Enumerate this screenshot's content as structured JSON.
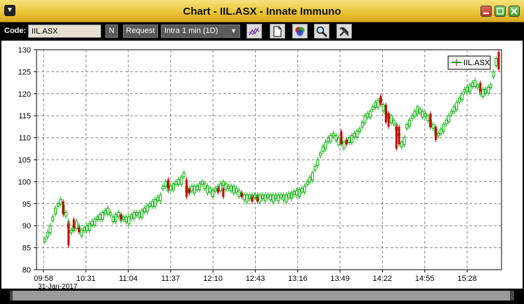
{
  "window": {
    "title": "Chart - IIL.ASX - Innate Immuno",
    "menu_glyph": "▼"
  },
  "toolbar": {
    "code_label": "Code:",
    "code_value": "IIL.ASX",
    "n_label": "N",
    "request_label": "Request",
    "interval_value": "Intra 1 min (1D)",
    "icons": [
      "indicator-chart-icon",
      "document-icon",
      "color-palette-icon",
      "zoom-icon",
      "tools-icon"
    ]
  },
  "chart_data": {
    "type": "candlestick",
    "legend": "IIL.ASX",
    "legend_placement": "top-right",
    "grid": true,
    "ylim": [
      80,
      130
    ],
    "yticks": [
      80,
      85,
      90,
      95,
      100,
      105,
      110,
      115,
      120,
      125,
      130
    ],
    "xticks": [
      "09:58",
      "10:31",
      "11:04",
      "11:37",
      "12:10",
      "12:43",
      "13:16",
      "13:49",
      "14:22",
      "14:55",
      "15:28"
    ],
    "xdate": "31-Jan-2017",
    "colors": {
      "up": "#00b000",
      "down": "#cc0000",
      "grid": "#888888"
    },
    "close_path": [
      [
        0,
        87
      ],
      [
        2,
        90
      ],
      [
        4,
        94
      ],
      [
        6,
        96
      ],
      [
        8,
        93
      ],
      [
        10,
        89
      ],
      [
        12,
        91
      ],
      [
        14,
        89
      ],
      [
        16,
        90
      ],
      [
        18,
        91
      ],
      [
        20,
        92
      ],
      [
        22,
        93
      ],
      [
        24,
        94
      ],
      [
        26,
        92
      ],
      [
        28,
        93
      ],
      [
        30,
        92
      ],
      [
        32,
        92
      ],
      [
        34,
        93
      ],
      [
        36,
        93
      ],
      [
        38,
        94
      ],
      [
        40,
        95
      ],
      [
        42,
        96
      ],
      [
        44,
        97
      ],
      [
        45,
        99
      ],
      [
        46,
        100
      ],
      [
        48,
        99
      ],
      [
        50,
        100
      ],
      [
        52,
        101
      ],
      [
        53,
        102
      ],
      [
        54,
        99
      ],
      [
        55,
        98
      ],
      [
        56,
        99
      ],
      [
        58,
        99
      ],
      [
        60,
        100
      ],
      [
        62,
        99
      ],
      [
        64,
        98
      ],
      [
        66,
        99
      ],
      [
        68,
        100
      ],
      [
        70,
        99
      ],
      [
        72,
        99
      ],
      [
        74,
        98
      ],
      [
        76,
        97
      ],
      [
        78,
        97
      ],
      [
        80,
        97
      ],
      [
        82,
        97
      ],
      [
        84,
        97
      ],
      [
        86,
        97
      ],
      [
        88,
        97
      ],
      [
        90,
        97
      ],
      [
        92,
        97
      ],
      [
        94,
        97.5
      ],
      [
        96,
        98
      ],
      [
        98,
        98.5
      ],
      [
        99,
        99
      ],
      [
        100,
        100
      ],
      [
        102,
        102
      ],
      [
        104,
        105
      ],
      [
        106,
        108
      ],
      [
        108,
        110
      ],
      [
        110,
        111
      ],
      [
        112,
        110
      ],
      [
        114,
        109
      ],
      [
        116,
        110
      ],
      [
        118,
        111
      ],
      [
        120,
        112
      ],
      [
        122,
        115
      ],
      [
        124,
        116
      ],
      [
        125,
        117
      ],
      [
        126,
        118
      ],
      [
        128,
        119
      ],
      [
        130,
        116
      ],
      [
        132,
        115
      ],
      [
        134,
        113
      ],
      [
        135,
        111
      ],
      [
        136,
        109
      ],
      [
        137,
        110
      ],
      [
        138,
        113
      ],
      [
        140,
        115
      ],
      [
        142,
        117
      ],
      [
        144,
        116
      ],
      [
        146,
        115
      ],
      [
        148,
        113
      ],
      [
        150,
        111
      ],
      [
        152,
        113
      ],
      [
        154,
        115
      ],
      [
        156,
        117
      ],
      [
        158,
        119
      ],
      [
        160,
        121
      ],
      [
        162,
        122
      ],
      [
        164,
        123
      ],
      [
        166,
        121
      ],
      [
        168,
        121
      ],
      [
        170,
        122
      ],
      [
        171,
        125
      ],
      [
        172,
        128
      ],
      [
        173,
        130
      ]
    ],
    "down_bars": [
      [
        7,
        96,
        92
      ],
      [
        9,
        91,
        85
      ],
      [
        11,
        92,
        89
      ],
      [
        13,
        90,
        88
      ],
      [
        29,
        93,
        91
      ],
      [
        47,
        101,
        98
      ],
      [
        54,
        101,
        96
      ],
      [
        55,
        99,
        97
      ],
      [
        66,
        99,
        97
      ],
      [
        68,
        99,
        96
      ],
      [
        75,
        98,
        96
      ],
      [
        79,
        97,
        95
      ],
      [
        81,
        97,
        95
      ],
      [
        113,
        112,
        108
      ],
      [
        115,
        110,
        108
      ],
      [
        128,
        120,
        117
      ],
      [
        130,
        118,
        113
      ],
      [
        131,
        116,
        112
      ],
      [
        134,
        113,
        107
      ],
      [
        135,
        113,
        108
      ],
      [
        147,
        116,
        112
      ],
      [
        149,
        113,
        109
      ],
      [
        166,
        123,
        120
      ],
      [
        173,
        130,
        125
      ]
    ]
  },
  "scrollbar": {
    "label": "horizontal-scrollbar"
  }
}
